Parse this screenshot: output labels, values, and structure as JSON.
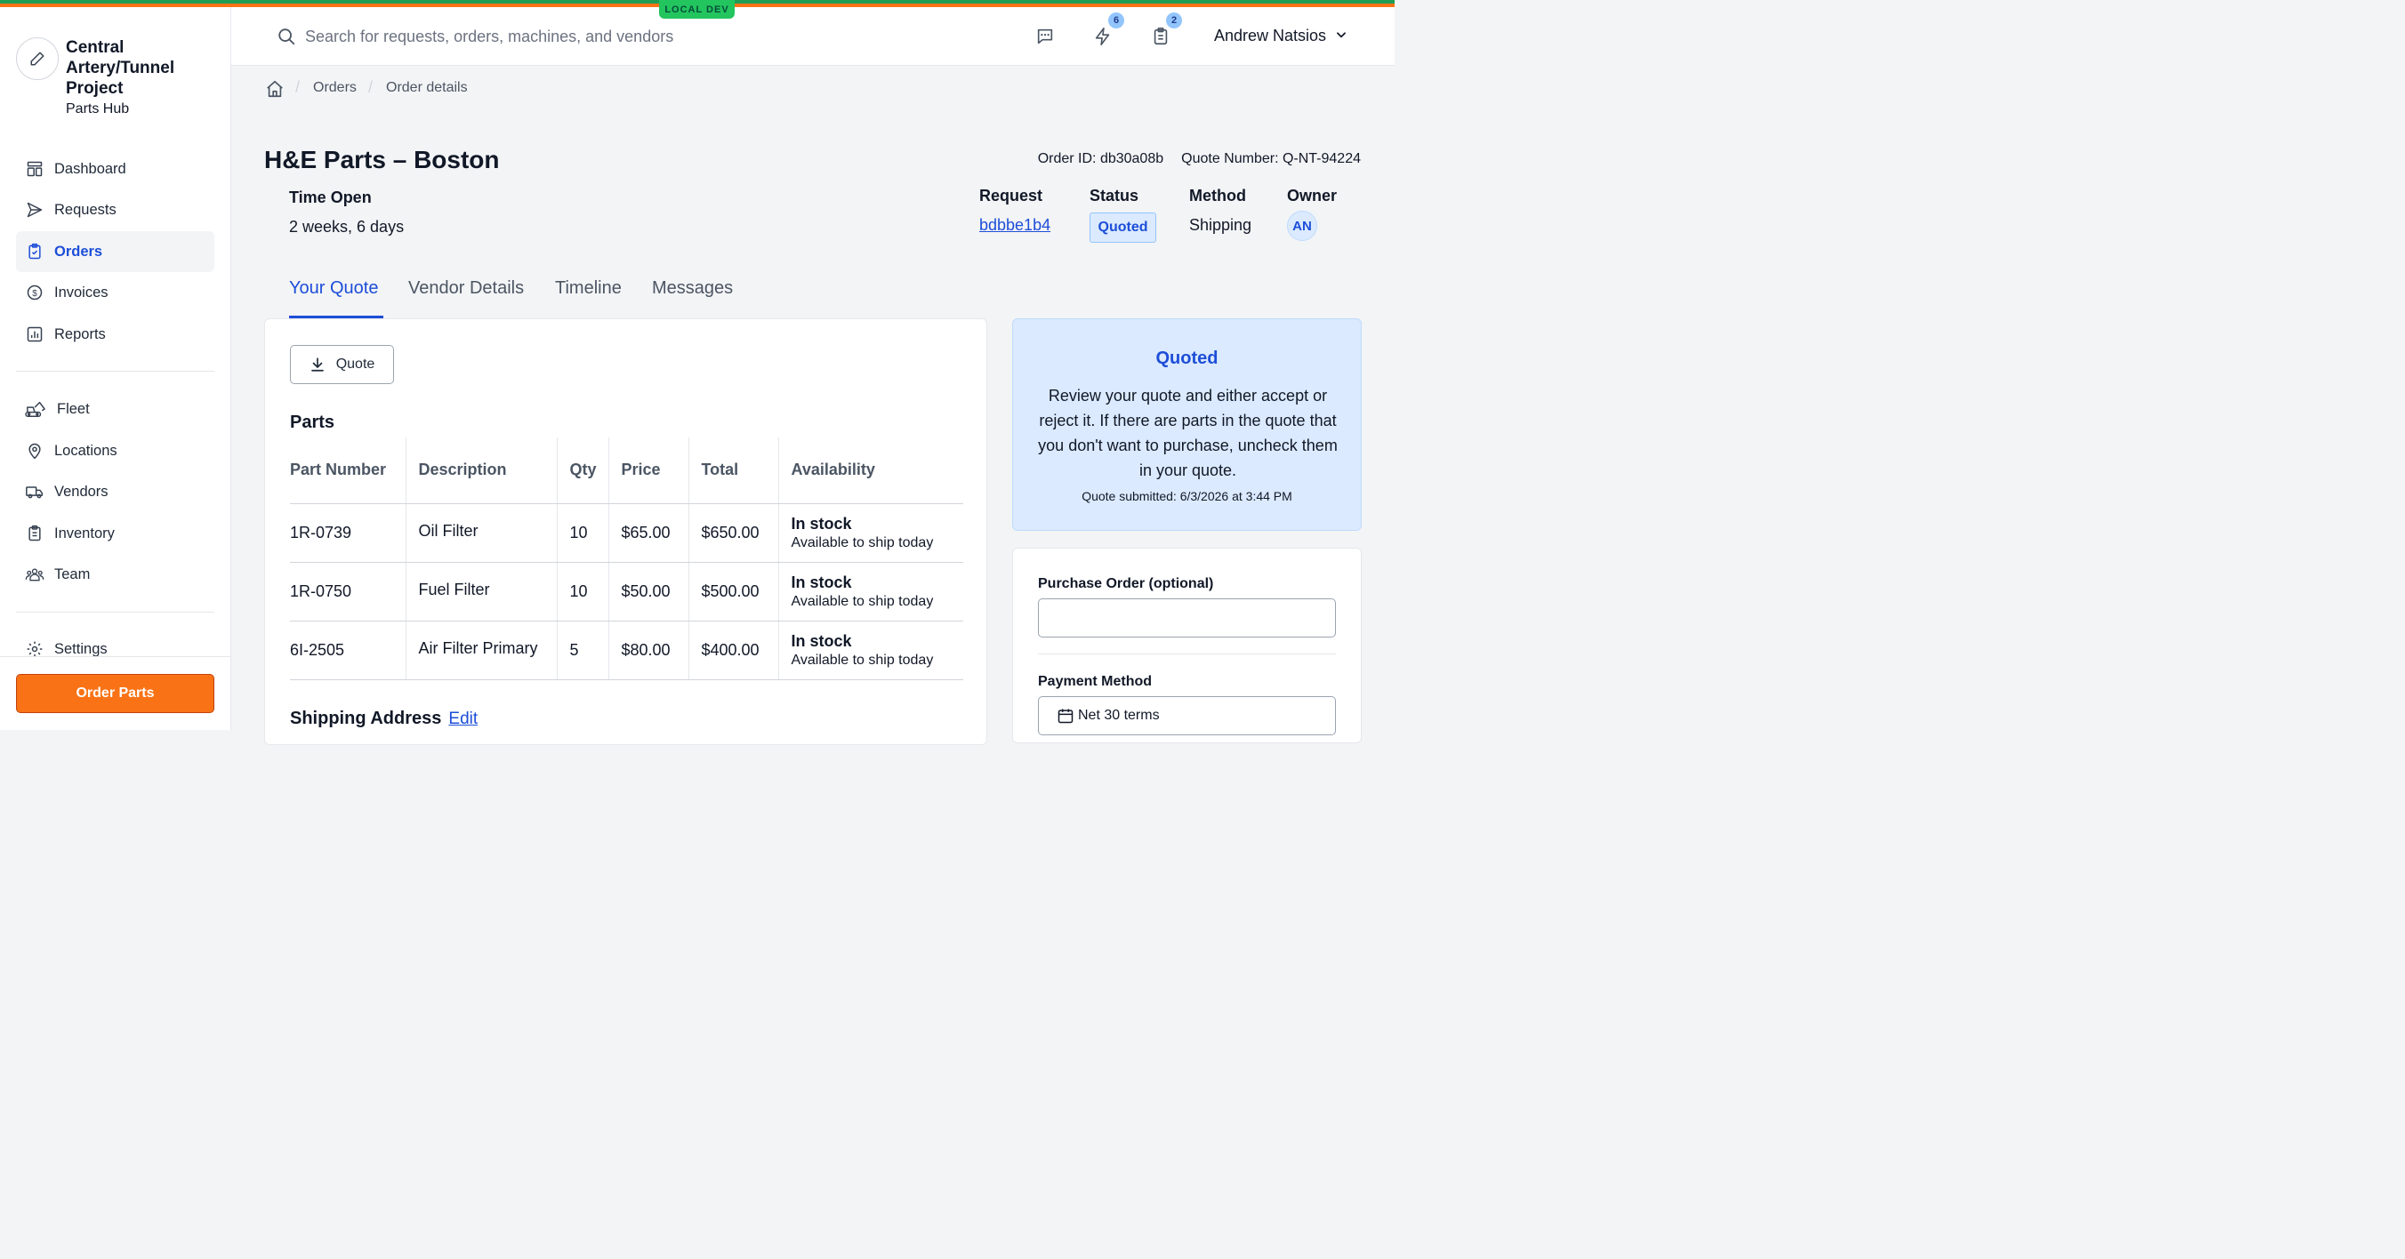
{
  "env_badge": "LOCAL DEV",
  "project": {
    "name": "Central Artery/Tunnel Project",
    "subtitle": "Parts Hub"
  },
  "nav": {
    "main": [
      "Dashboard",
      "Requests",
      "Orders",
      "Invoices",
      "Reports"
    ],
    "secondary": [
      "Fleet",
      "Locations",
      "Vendors",
      "Inventory",
      "Team"
    ],
    "settings": "Settings",
    "active": "Orders"
  },
  "order_parts_label": "Order Parts",
  "search": {
    "placeholder": "Search for requests, orders, machines, and vendors",
    "value": ""
  },
  "header": {
    "activity_count": "6",
    "tasks_count": "2",
    "user_name": "Andrew Natsios"
  },
  "breadcrumb": [
    "Orders",
    "Order details"
  ],
  "order": {
    "vendor": "H&E Parts – Boston",
    "order_id": "Order ID: db30a08b",
    "quote_number": "Quote Number: Q-NT-94224",
    "time_open_label": "Time Open",
    "time_open": "2 weeks, 6 days",
    "request_label": "Request",
    "request_id": "bdbbe1b4",
    "status_label": "Status",
    "status": "Quoted",
    "method_label": "Method",
    "method": "Shipping",
    "owner_label": "Owner",
    "owner_initials": "AN"
  },
  "tabs": [
    "Your Quote",
    "Vendor Details",
    "Timeline",
    "Messages"
  ],
  "quote_button": "Quote",
  "parts": {
    "title": "Parts",
    "columns": [
      "Part Number",
      "Description",
      "Qty",
      "Price",
      "Total",
      "Availability"
    ],
    "rows": [
      {
        "part_number": "1R-0739",
        "description": "Oil Filter",
        "qty": "10",
        "price": "$65.00",
        "total": "$650.00",
        "availability": "In stock",
        "availability_note": "Available to ship today"
      },
      {
        "part_number": "1R-0750",
        "description": "Fuel Filter",
        "qty": "10",
        "price": "$50.00",
        "total": "$500.00",
        "availability": "In stock",
        "availability_note": "Available to ship today"
      },
      {
        "part_number": "6I-2505",
        "description": "Air Filter Primary",
        "qty": "5",
        "price": "$80.00",
        "total": "$400.00",
        "availability": "In stock",
        "availability_note": "Available to ship today"
      }
    ]
  },
  "shipping": {
    "title": "Shipping Address",
    "edit": "Edit"
  },
  "quote_status": {
    "title": "Quoted",
    "message": "Review your quote and either accept or reject it. If there are parts in the quote that you don't want to purchase, uncheck them in your quote.",
    "submitted": "Quote submitted: 6/3/2026 at 3:44 PM"
  },
  "form": {
    "po_label": "Purchase Order (optional)",
    "po_value": "",
    "payment_label": "Payment Method",
    "payment_value": "Net 30 terms"
  },
  "colors": {
    "accent": "#1d4ed8",
    "order_button": "#f97316",
    "env_badge": "#22c55e",
    "status_bg": "#dbeafe"
  }
}
